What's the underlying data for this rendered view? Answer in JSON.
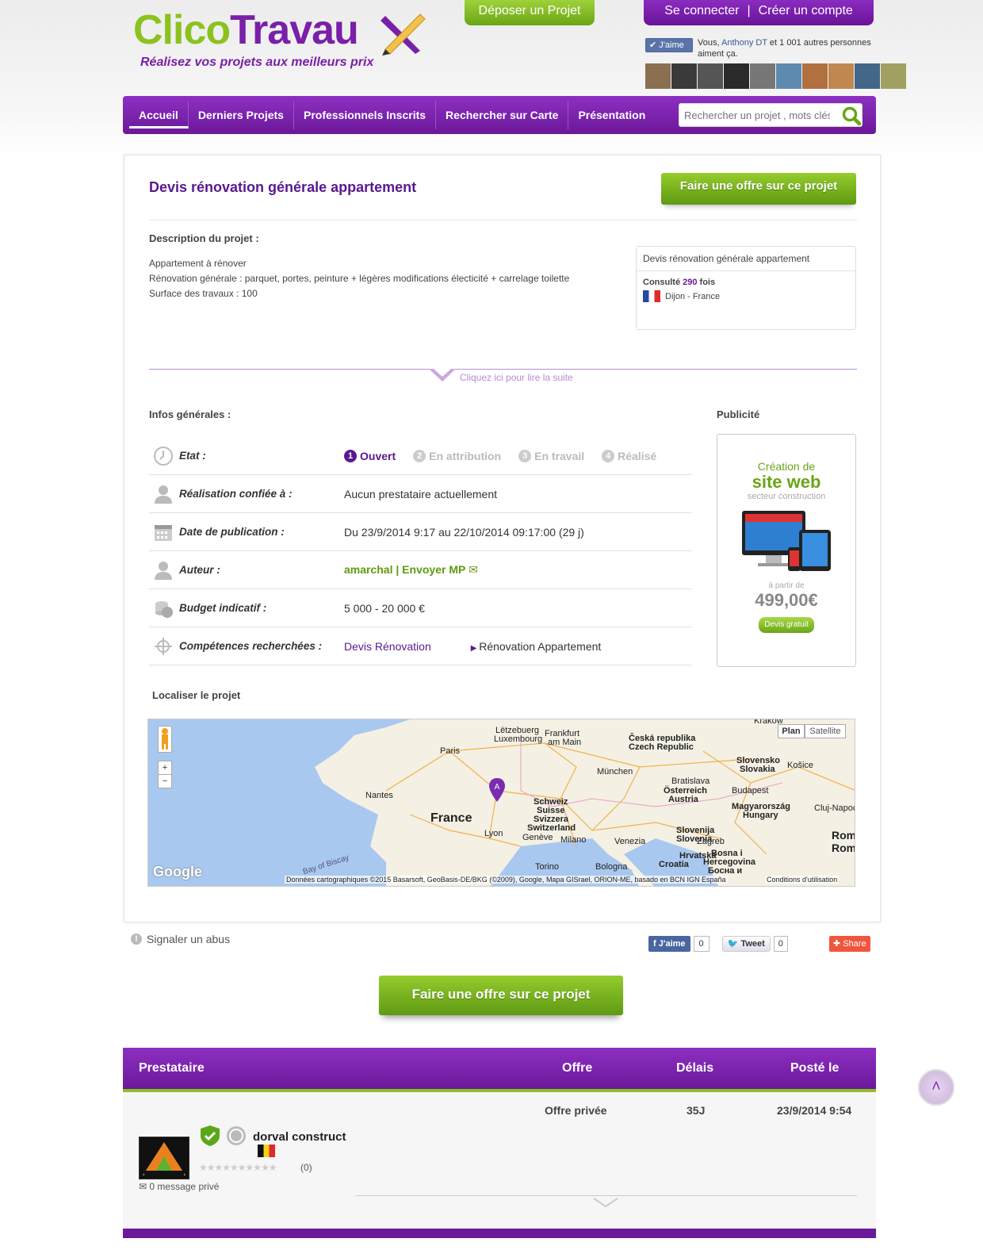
{
  "header": {
    "logo_part1": "Clico",
    "logo_part2": "Travau",
    "logo_part3": "x",
    "tagline": "Réalisez vos projets aux meilleurs prix",
    "deposer": "Déposer un Projet",
    "connect": "Se connecter",
    "sep": "|",
    "create": "Créer un compte",
    "fb_like": "J'aime",
    "fb_text_1": "Vous, ",
    "fb_text_name": "Anthony DT",
    "fb_text_2": " et 1 001 autres personnes aiment ça."
  },
  "nav": {
    "items": [
      "Accueil",
      "Derniers Projets",
      "Professionnels Inscrits",
      "Rechercher sur Carte",
      "Présentation"
    ],
    "search_placeholder": "Rechercher un projet , mots clés"
  },
  "project": {
    "title": "Devis rénovation générale appartement",
    "offer_button": "Faire une offre sur ce projet",
    "desc_label": "Description du projet :",
    "desc_lines": [
      "Appartement à rénover",
      "Rénovation générale : parquet, portes, peinture + légères modifications électicité + carrelage toilette",
      "Surface des travaux : 100"
    ],
    "box_title": "Devis rénovation générale appartement",
    "consulte_1": "Consulté ",
    "consulte_n": "290",
    "consulte_2": " fois",
    "location": "Dijon - France",
    "readmore": "Cliquez ici pour lire la suite",
    "infos_label": "Infos générales :",
    "pub_label": "Publicité",
    "etat_label": "Etat :",
    "steps": [
      {
        "n": "1",
        "label": "Ouvert"
      },
      {
        "n": "2",
        "label": "En attribution"
      },
      {
        "n": "3",
        "label": "En travail"
      },
      {
        "n": "4",
        "label": "Réalisé"
      }
    ],
    "realisation_label": "Réalisation confiée à :",
    "realisation_value": "Aucun prestataire actuellement",
    "date_label": "Date de publication :",
    "date_value": "Du 23/9/2014 9:17 au 22/10/2014 09:17:00 (29 j)",
    "auteur_label": "Auteur :",
    "auteur_value": "amarchal",
    "envoyer_mp": "| Envoyer MP",
    "budget_label": "Budget indicatif :",
    "budget_value": "5 000 - 20 000 €",
    "comp_label": "Compétences recherchées :",
    "comp_value1": "Devis Rénovation",
    "comp_value2": "Rénovation Appartement",
    "localiser_label": "Localiser le projet"
  },
  "ad": {
    "l1": "Création de",
    "l2": "site web",
    "l3": "secteur construction",
    "l4": "à partir de",
    "price": "499,00€",
    "btn": "Devis gratuit"
  },
  "map": {
    "plan": "Plan",
    "satellite": "Satellite",
    "marker": "A",
    "google": "Google",
    "credits": "Données cartographiques ©2015 Basarsoft, GeoBasis-DE/BKG (©2009), Google, Mapa GISrael, ORION-ME, basado en BCN IGN España",
    "conditions": "Conditions d'utilisation",
    "labels": [
      "Paris",
      "France",
      "Nantes",
      "Lyon",
      "Lëtzebuerg",
      "Luxembourg",
      "Frankfurt",
      "am Main",
      "München",
      "Schweiz",
      "Suisse",
      "Svizzera",
      "Switzerland",
      "Genève",
      "Milano",
      "Venezia",
      "Torino",
      "Bologna",
      "Česká republika",
      "Czech Republic",
      "Slovensko",
      "Slovakia",
      "Košice",
      "Bratislava",
      "Österreich",
      "Austria",
      "Budapest",
      "Magyarország",
      "Hungary",
      "Slovenija",
      "Slovenia",
      "Zagreb",
      "Hrvatska",
      "Croatia",
      "Bosna i",
      "Hercegovina",
      "Босна и",
      "Cluj-Napoca",
      "Rom",
      "Rom",
      "Krakow",
      "Bay of Biscay"
    ]
  },
  "footer_actions": {
    "abuse": "Signaler un abus",
    "fb_like": "J'aime",
    "fb_count": "0",
    "tweet": "Tweet",
    "tweet_count": "0",
    "share": "Share"
  },
  "offers_table": {
    "col_prestataire": "Prestataire",
    "col_offre": "Offre",
    "col_delais": "Délais",
    "col_poste": "Posté le",
    "row": {
      "offre": "Offre privée",
      "delais": "35J",
      "poste": "23/9/2014 9:54",
      "name": "dorval construct",
      "rating_count": "(0)",
      "messages": "0 message privé"
    }
  },
  "colors": {
    "purple": "#6b189a",
    "green": "#6aa515",
    "lime": "#8cc21f"
  }
}
